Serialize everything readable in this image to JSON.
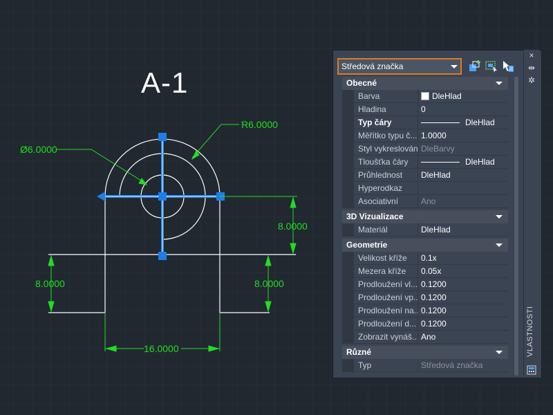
{
  "drawing": {
    "title": "A-1",
    "dimensions": {
      "radius": "R6.0000",
      "diameter": "Ø6.0000",
      "right_height": "8.0000",
      "left_height": "8.0000",
      "right_lower_height": "8.0000",
      "width": "16.0000"
    }
  },
  "colors": {
    "accent": "#e07a20",
    "dimension": "#22dd22",
    "grip": "#1e7ee8",
    "background": "#212830"
  },
  "palette": {
    "title": "VLASTNOSTI",
    "selector_value": "Středová značka",
    "buttons": {
      "close": "×",
      "autohide": "⇹",
      "settings": "✲",
      "quick_select_icon": "quick-select-icon",
      "select_objects_icon": "select-objects-icon",
      "toggle_pickadd_icon": "pickadd-icon"
    },
    "sections": [
      {
        "name": "Obecné",
        "rows": [
          {
            "label": "Barva",
            "value": "DleHlad",
            "swatch": true
          },
          {
            "label": "Hladina",
            "value": "0"
          },
          {
            "label": "Typ čáry",
            "value": "DleHlad",
            "line": true,
            "bold_label": true
          },
          {
            "label": "Měřítko typu č...",
            "value": "1.0000"
          },
          {
            "label": "Styl vykreslování",
            "value": "DleBarvy",
            "dim": true
          },
          {
            "label": "Tloušťka čáry",
            "value": "DleHlad",
            "line": true
          },
          {
            "label": "Průhlednost",
            "value": "DleHlad"
          },
          {
            "label": "Hyperodkaz",
            "value": ""
          },
          {
            "label": "Asociativní",
            "value": "Ano",
            "dim": true
          }
        ]
      },
      {
        "name": "3D Vizualizace",
        "rows": [
          {
            "label": "Materiál",
            "value": "DleHlad"
          }
        ]
      },
      {
        "name": "Geometrie",
        "rows": [
          {
            "label": "Velikost kříže",
            "value": "0.1x"
          },
          {
            "label": "Mezera kříže",
            "value": "0.05x"
          },
          {
            "label": "Prodloužení vl...",
            "value": "0.1200"
          },
          {
            "label": "Prodloužení vp...",
            "value": "0.1200"
          },
          {
            "label": "Prodloužení na...",
            "value": "0.1200"
          },
          {
            "label": "Prodloužení d...",
            "value": "0.1200"
          },
          {
            "label": "Zobrazit vynáš...",
            "value": "Ano"
          }
        ]
      },
      {
        "name": "Různé",
        "rows": [
          {
            "label": "Typ",
            "value": "Středová značka",
            "dim": true
          }
        ]
      }
    ]
  }
}
